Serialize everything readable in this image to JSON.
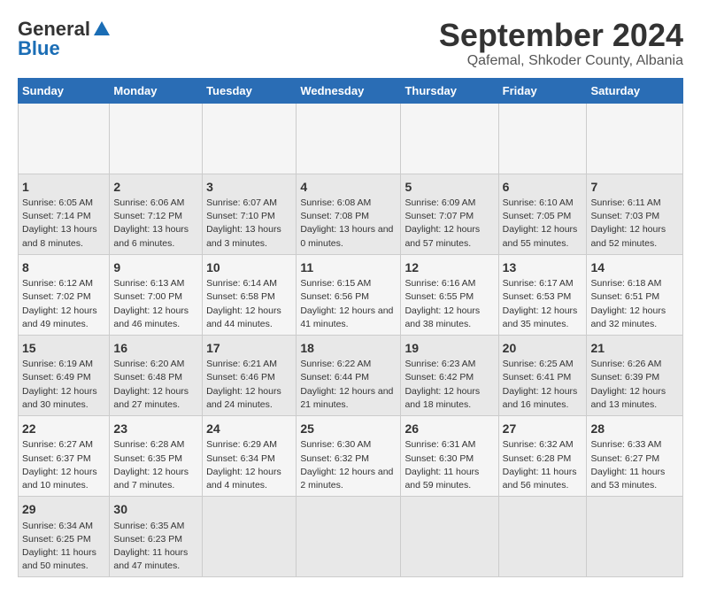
{
  "header": {
    "logo_line1": "General",
    "logo_line2": "Blue",
    "title": "September 2024",
    "subtitle": "Qafemal, Shkoder County, Albania"
  },
  "calendar": {
    "days_of_week": [
      "Sunday",
      "Monday",
      "Tuesday",
      "Wednesday",
      "Thursday",
      "Friday",
      "Saturday"
    ],
    "weeks": [
      [
        null,
        null,
        null,
        null,
        null,
        null,
        null
      ]
    ],
    "cells": [
      {
        "day": null,
        "info": null
      },
      {
        "day": null,
        "info": null
      },
      {
        "day": null,
        "info": null
      },
      {
        "day": null,
        "info": null
      },
      {
        "day": null,
        "info": null
      },
      {
        "day": null,
        "info": null
      },
      {
        "day": null,
        "info": null
      },
      {
        "day": "1",
        "sunrise": "6:05 AM",
        "sunset": "7:14 PM",
        "daylight": "13 hours and 8 minutes."
      },
      {
        "day": "2",
        "sunrise": "6:06 AM",
        "sunset": "7:12 PM",
        "daylight": "13 hours and 6 minutes."
      },
      {
        "day": "3",
        "sunrise": "6:07 AM",
        "sunset": "7:10 PM",
        "daylight": "13 hours and 3 minutes."
      },
      {
        "day": "4",
        "sunrise": "6:08 AM",
        "sunset": "7:08 PM",
        "daylight": "13 hours and 0 minutes."
      },
      {
        "day": "5",
        "sunrise": "6:09 AM",
        "sunset": "7:07 PM",
        "daylight": "12 hours and 57 minutes."
      },
      {
        "day": "6",
        "sunrise": "6:10 AM",
        "sunset": "7:05 PM",
        "daylight": "12 hours and 55 minutes."
      },
      {
        "day": "7",
        "sunrise": "6:11 AM",
        "sunset": "7:03 PM",
        "daylight": "12 hours and 52 minutes."
      },
      {
        "day": "8",
        "sunrise": "6:12 AM",
        "sunset": "7:02 PM",
        "daylight": "12 hours and 49 minutes."
      },
      {
        "day": "9",
        "sunrise": "6:13 AM",
        "sunset": "7:00 PM",
        "daylight": "12 hours and 46 minutes."
      },
      {
        "day": "10",
        "sunrise": "6:14 AM",
        "sunset": "6:58 PM",
        "daylight": "12 hours and 44 minutes."
      },
      {
        "day": "11",
        "sunrise": "6:15 AM",
        "sunset": "6:56 PM",
        "daylight": "12 hours and 41 minutes."
      },
      {
        "day": "12",
        "sunrise": "6:16 AM",
        "sunset": "6:55 PM",
        "daylight": "12 hours and 38 minutes."
      },
      {
        "day": "13",
        "sunrise": "6:17 AM",
        "sunset": "6:53 PM",
        "daylight": "12 hours and 35 minutes."
      },
      {
        "day": "14",
        "sunrise": "6:18 AM",
        "sunset": "6:51 PM",
        "daylight": "12 hours and 32 minutes."
      },
      {
        "day": "15",
        "sunrise": "6:19 AM",
        "sunset": "6:49 PM",
        "daylight": "12 hours and 30 minutes."
      },
      {
        "day": "16",
        "sunrise": "6:20 AM",
        "sunset": "6:48 PM",
        "daylight": "12 hours and 27 minutes."
      },
      {
        "day": "17",
        "sunrise": "6:21 AM",
        "sunset": "6:46 PM",
        "daylight": "12 hours and 24 minutes."
      },
      {
        "day": "18",
        "sunrise": "6:22 AM",
        "sunset": "6:44 PM",
        "daylight": "12 hours and 21 minutes."
      },
      {
        "day": "19",
        "sunrise": "6:23 AM",
        "sunset": "6:42 PM",
        "daylight": "12 hours and 18 minutes."
      },
      {
        "day": "20",
        "sunrise": "6:25 AM",
        "sunset": "6:41 PM",
        "daylight": "12 hours and 16 minutes."
      },
      {
        "day": "21",
        "sunrise": "6:26 AM",
        "sunset": "6:39 PM",
        "daylight": "12 hours and 13 minutes."
      },
      {
        "day": "22",
        "sunrise": "6:27 AM",
        "sunset": "6:37 PM",
        "daylight": "12 hours and 10 minutes."
      },
      {
        "day": "23",
        "sunrise": "6:28 AM",
        "sunset": "6:35 PM",
        "daylight": "12 hours and 7 minutes."
      },
      {
        "day": "24",
        "sunrise": "6:29 AM",
        "sunset": "6:34 PM",
        "daylight": "12 hours and 4 minutes."
      },
      {
        "day": "25",
        "sunrise": "6:30 AM",
        "sunset": "6:32 PM",
        "daylight": "12 hours and 2 minutes."
      },
      {
        "day": "26",
        "sunrise": "6:31 AM",
        "sunset": "6:30 PM",
        "daylight": "11 hours and 59 minutes."
      },
      {
        "day": "27",
        "sunrise": "6:32 AM",
        "sunset": "6:28 PM",
        "daylight": "11 hours and 56 minutes."
      },
      {
        "day": "28",
        "sunrise": "6:33 AM",
        "sunset": "6:27 PM",
        "daylight": "11 hours and 53 minutes."
      },
      {
        "day": "29",
        "sunrise": "6:34 AM",
        "sunset": "6:25 PM",
        "daylight": "11 hours and 50 minutes."
      },
      {
        "day": "30",
        "sunrise": "6:35 AM",
        "sunset": "6:23 PM",
        "daylight": "11 hours and 47 minutes."
      },
      {
        "day": null,
        "info": null
      },
      {
        "day": null,
        "info": null
      },
      {
        "day": null,
        "info": null
      },
      {
        "day": null,
        "info": null
      },
      {
        "day": null,
        "info": null
      }
    ]
  }
}
